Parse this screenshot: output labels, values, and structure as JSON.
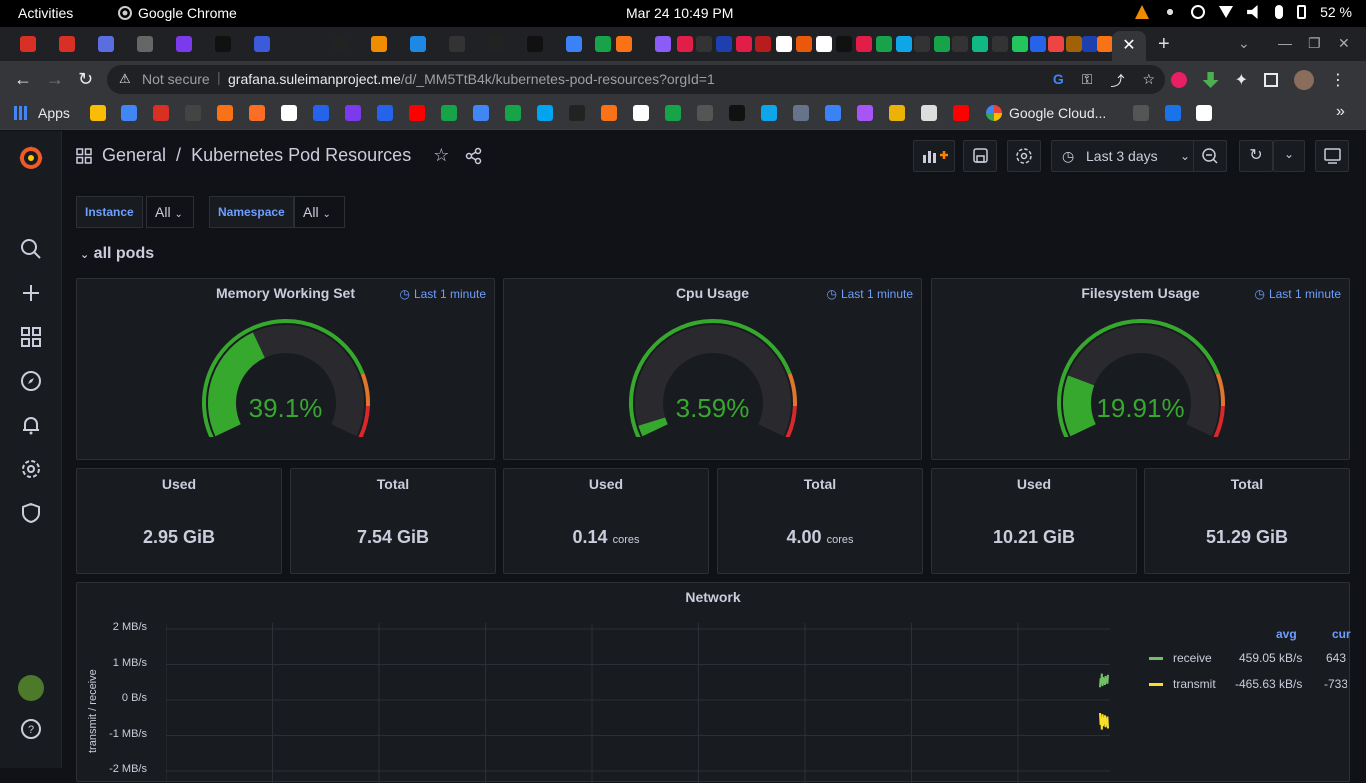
{
  "os": {
    "activities": "Activities",
    "app_name": "Google Chrome",
    "datetime": "Mar 24  10:49 PM",
    "battery": "52 %"
  },
  "browser": {
    "security_label": "Not secure",
    "url_host": "grafana.suleimanproject.me",
    "url_path": "/d/_MM5TtB4k/kubernetes-pod-resources?orgId=1",
    "bookmarks": {
      "apps": "Apps",
      "google_cloud": "Google Cloud..."
    }
  },
  "dashboard": {
    "breadcrumb_folder": "General",
    "breadcrumb_sep": "/",
    "title": "Kubernetes Pod Resources",
    "time_range": "Last 3 days",
    "variables": [
      {
        "label": "Instance",
        "value": "All"
      },
      {
        "label": "Namespace",
        "value": "All"
      }
    ],
    "row_title": "all pods"
  },
  "gauges": [
    {
      "title": "Memory Working Set",
      "info": "Last 1 minute",
      "value_text": "39.1%",
      "value": 39.1
    },
    {
      "title": "Cpu Usage",
      "info": "Last 1 minute",
      "value_text": "3.59%",
      "value": 3.59
    },
    {
      "title": "Filesystem Usage",
      "info": "Last 1 minute",
      "value_text": "19.91%",
      "value": 19.91
    }
  ],
  "stats": [
    {
      "title": "Used",
      "value": "2.95 GiB",
      "unit": ""
    },
    {
      "title": "Total",
      "value": "7.54 GiB",
      "unit": ""
    },
    {
      "title": "Used",
      "value": "0.14",
      "unit": "cores"
    },
    {
      "title": "Total",
      "value": "4.00",
      "unit": "cores"
    },
    {
      "title": "Used",
      "value": "10.21 GiB",
      "unit": ""
    },
    {
      "title": "Total",
      "value": "51.29 GiB",
      "unit": ""
    }
  ],
  "network": {
    "title": "Network",
    "ylabel": "transmit / receive",
    "yticks": [
      "2 MB/s",
      "1 MB/s",
      "0 B/s",
      "-1 MB/s",
      "-2 MB/s"
    ],
    "legend_headers": {
      "avg": "avg",
      "current": "cur"
    },
    "legend": [
      {
        "name": "receive",
        "color": "#73bf69",
        "avg": "459.05 kB/s",
        "current": "643"
      },
      {
        "name": "transmit",
        "color": "#fade2a",
        "avg": "-465.63 kB/s",
        "current": "-733"
      }
    ]
  },
  "chart_data": {
    "type": "line",
    "title": "Network",
    "ylabel": "transmit / receive",
    "ylim": [
      -2,
      2
    ],
    "yunit": "MB/s",
    "series": [
      {
        "name": "receive",
        "values": [
          0.459,
          0.643
        ]
      },
      {
        "name": "transmit",
        "values": [
          -0.466,
          -0.733
        ]
      }
    ]
  },
  "colors": {
    "accent_blue": "#6e9fff",
    "gauge_green": "#37a82e",
    "gauge_orange": "#e0752d",
    "gauge_red": "#d8282b"
  }
}
